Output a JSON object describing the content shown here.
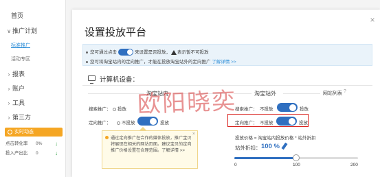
{
  "sidebar": {
    "home": "首页",
    "campaign": "推广计划",
    "standard": "标准推广",
    "activity_zone": "活动专区",
    "reports": "报表",
    "account": "账户",
    "tools": "工具",
    "third_party": "第三方",
    "realtime": {
      "title": "实时动态",
      "rows": [
        {
          "label": "点击转化率",
          "value": "0%"
        },
        {
          "label": "投入产出比",
          "value": "0"
        }
      ]
    }
  },
  "modal": {
    "title": "设置投放平台",
    "close": "×",
    "notice": {
      "line1_pre": "您可通过点击",
      "line1_mid": "来设置是否投放，",
      "line1_post": "表示暂不可投放",
      "line2_pre": "您可将淘宝站内的定向推广，才能在投放淘宝站外的定向推广 ",
      "line2_link": "了解详情 >>"
    },
    "section": "计算机设备：",
    "col_inside": "淘宝站内",
    "col_outside": "淘宝站外",
    "top_right_link": "网站列表",
    "inside": {
      "search_label": "搜索推广：",
      "search_value": "投放",
      "targeting_label": "定向推广：",
      "targeting_off": "不投放",
      "targeting_on": "投放"
    },
    "outside": {
      "search_label": "搜索推广：",
      "search_off": "不投放",
      "search_on": "投放",
      "targeting_label": "定向推广：",
      "targeting_off": "不投放",
      "targeting_on": "投放",
      "bid_desc": "投放价格 = 淘宝站内投放价格 * 站外折扣",
      "discount_label": "站外折扣：",
      "discount_value": "100 %",
      "slider_value": 100,
      "slider_ticks": [
        "0",
        "100",
        "200"
      ]
    },
    "tip": "通过定向推广在合作的媒体投放，推广宝贝将展现在相关的网站页面。建议宝贝的定向推广价格设置在合理范围。了解详情 >>"
  },
  "watermark": "欧阳晓奕",
  "colors": {
    "accent": "#2f6fc0",
    "highlight": "#d9211c",
    "orange": "#f5a623"
  }
}
